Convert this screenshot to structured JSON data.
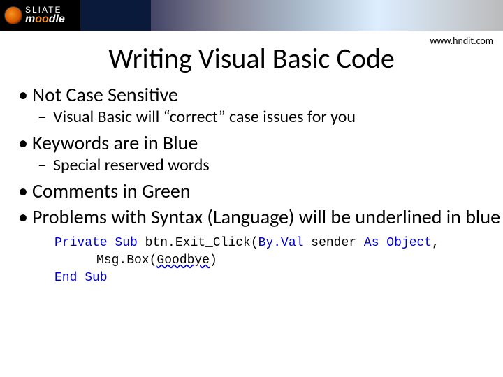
{
  "banner": {
    "logo_line1": "SLIATE",
    "logo_line2_pre": "m",
    "logo_line2_o": "oo",
    "logo_line2_post": "dle"
  },
  "url": "www.hndit.com",
  "title": "Writing Visual Basic Code",
  "bullets": [
    {
      "text": "Not Case Sensitive",
      "sub": [
        "Visual Basic will “correct” case issues for you"
      ]
    },
    {
      "text": "Keywords are in Blue",
      "sub": [
        "Special reserved words"
      ]
    },
    {
      "text": "Comments in Green",
      "sub": []
    },
    {
      "text": "Problems with Syntax (Language) will be underlined in blue",
      "sub": []
    }
  ],
  "code": {
    "line1": {
      "kw1": "Private Sub",
      "id1": " btn.Exit_Click(",
      "kw2": "By.Val",
      "id2": " sender ",
      "kw3": "As Object",
      "id3": ","
    },
    "line2": {
      "id1": "Msg.Box(",
      "err": "Goodbye",
      "id2": ")"
    },
    "line3": {
      "kw1": "End Sub"
    }
  }
}
